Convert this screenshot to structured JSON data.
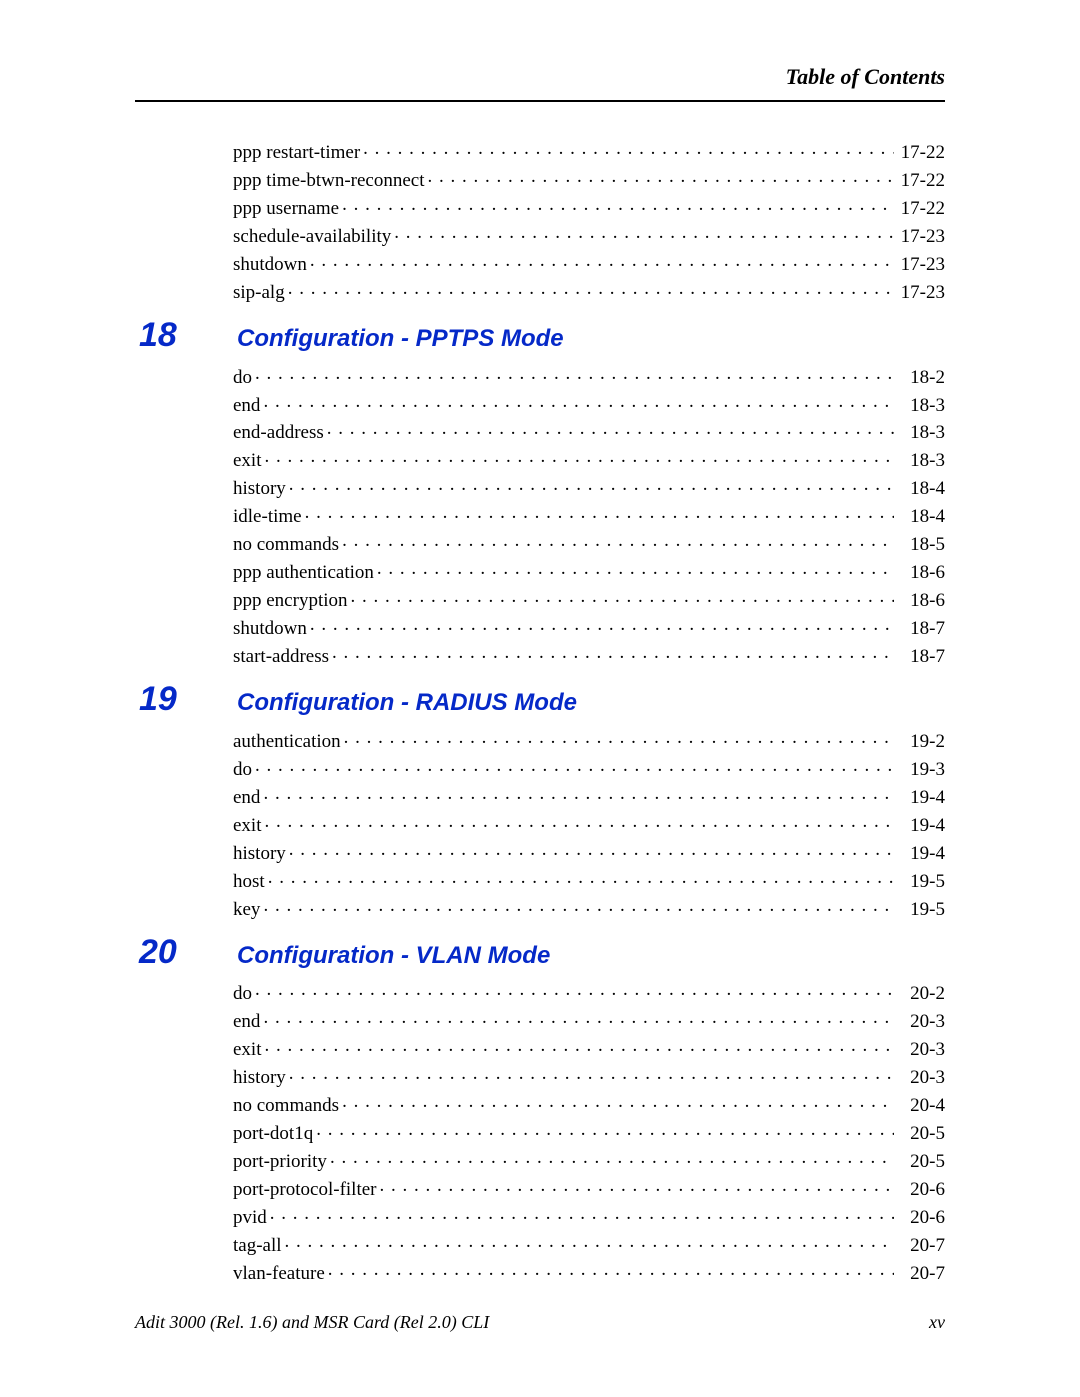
{
  "header": {
    "running_head": "Table of Contents"
  },
  "footer": {
    "left": "Adit 3000 (Rel. 1.6) and MSR Card (Rel 2.0) CLI",
    "right": "xv"
  },
  "pre_items": [
    {
      "label": "ppp restart-timer",
      "page": "17-22"
    },
    {
      "label": "ppp time-btwn-reconnect",
      "page": "17-22"
    },
    {
      "label": "ppp username",
      "page": "17-22"
    },
    {
      "label": "schedule-availability",
      "page": "17-23"
    },
    {
      "label": "shutdown",
      "page": "17-23"
    },
    {
      "label": "sip-alg",
      "page": "17-23"
    }
  ],
  "chapters": [
    {
      "number": "18",
      "title": "Configuration - PPTPS Mode",
      "items": [
        {
          "label": "do",
          "page": "18-2"
        },
        {
          "label": "end",
          "page": "18-3"
        },
        {
          "label": "end-address",
          "page": "18-3"
        },
        {
          "label": "exit",
          "page": "18-3"
        },
        {
          "label": "history",
          "page": "18-4"
        },
        {
          "label": "idle-time",
          "page": "18-4"
        },
        {
          "label": "no commands",
          "page": "18-5"
        },
        {
          "label": "ppp authentication",
          "page": "18-6"
        },
        {
          "label": "ppp encryption",
          "page": "18-6"
        },
        {
          "label": "shutdown",
          "page": "18-7"
        },
        {
          "label": "start-address",
          "page": "18-7"
        }
      ]
    },
    {
      "number": "19",
      "title": "Configuration - RADIUS Mode",
      "items": [
        {
          "label": "authentication",
          "page": "19-2"
        },
        {
          "label": "do",
          "page": "19-3"
        },
        {
          "label": "end",
          "page": "19-4"
        },
        {
          "label": "exit",
          "page": "19-4"
        },
        {
          "label": "history",
          "page": "19-4"
        },
        {
          "label": "host",
          "page": "19-5"
        },
        {
          "label": "key",
          "page": "19-5"
        }
      ]
    },
    {
      "number": "20",
      "title": "Configuration - VLAN Mode",
      "items": [
        {
          "label": "do",
          "page": "20-2"
        },
        {
          "label": "end",
          "page": "20-3"
        },
        {
          "label": "exit",
          "page": "20-3"
        },
        {
          "label": "history",
          "page": "20-3"
        },
        {
          "label": "no commands",
          "page": "20-4"
        },
        {
          "label": "port-dot1q",
          "page": "20-5"
        },
        {
          "label": "port-priority",
          "page": "20-5"
        },
        {
          "label": "port-protocol-filter",
          "page": "20-6"
        },
        {
          "label": "pvid",
          "page": "20-6"
        },
        {
          "label": "tag-all",
          "page": "20-7"
        },
        {
          "label": "vlan-feature",
          "page": "20-7"
        }
      ]
    }
  ]
}
